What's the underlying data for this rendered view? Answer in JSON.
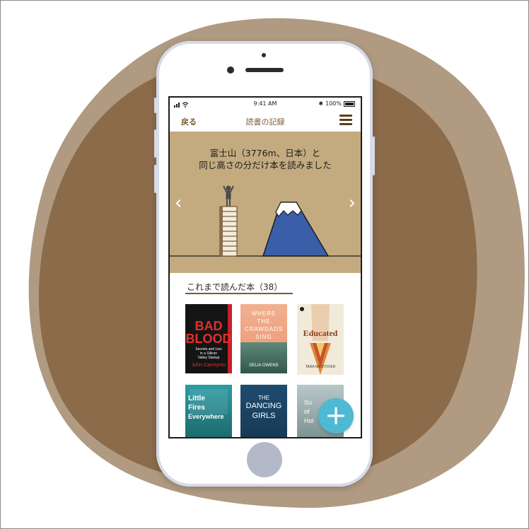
{
  "status": {
    "time": "9:41 AM",
    "battery": "100%"
  },
  "nav": {
    "back_label": "戻る",
    "title": "読書の記録"
  },
  "hero": {
    "line1": "富士山（3776m、日本）と",
    "line2": "同じ高さの分だけ本を読みました",
    "prev_arrow": "‹",
    "next_arrow": "›"
  },
  "books_section": {
    "title": "これまで読んだ本（38）"
  },
  "books": [
    {
      "title_line1": "BAD",
      "title_line2": "BLOOD",
      "subtitle1": "Secrets and Lies",
      "subtitle2": "in a Silicon",
      "subtitle3": "Valley Startup",
      "author": "John Carreyrou"
    },
    {
      "title_line1": "WHERE",
      "title_line2": "THE",
      "title_line3": "CRAWDADS",
      "title_line4": "SING",
      "author": "DELIA OWENS"
    },
    {
      "title": "Educated",
      "author": "TARA WESTOVER"
    },
    {
      "title_line1": "Little",
      "title_line2": "Fires",
      "title_line3": "Everywhere"
    },
    {
      "title_line1": "THE",
      "title_line2": "DANCING",
      "title_line3": "GIRLS"
    },
    {
      "title_line1": "Su",
      "title_line2": "of",
      "title_line3": "Hol"
    }
  ],
  "fab": {
    "icon": "plus-icon",
    "label": "+"
  },
  "colors": {
    "blob_outer": "#b09a82",
    "blob_inner": "#8c6b4a",
    "hero_bg": "#c3ab7f",
    "accent": "#7a5b2f",
    "fab": "#4fb8d3"
  }
}
